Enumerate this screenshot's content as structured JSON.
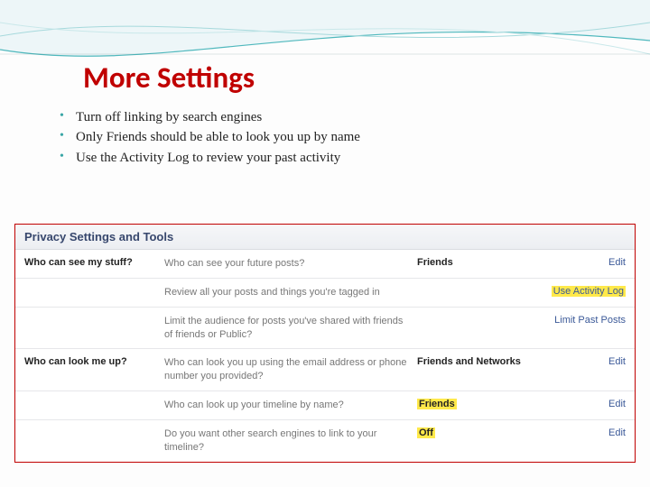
{
  "title": "More Settings",
  "bullets": [
    "Turn off linking by search engines",
    "Only Friends should be able to look you up by name",
    "Use the Activity Log to review your past activity"
  ],
  "panel": {
    "header": "Privacy Settings and Tools",
    "sections": [
      {
        "heading": "Who can see my stuff?",
        "rows": [
          {
            "desc": "Who can see your future posts?",
            "value": "Friends",
            "value_hl": false,
            "action": "Edit",
            "action_hl": false
          },
          {
            "desc": "Review all your posts and things you're tagged in",
            "value": "",
            "value_hl": false,
            "action": "Use Activity Log",
            "action_hl": true
          },
          {
            "desc": "Limit the audience for posts you've shared with friends of friends or Public?",
            "value": "",
            "value_hl": false,
            "action": "Limit Past Posts",
            "action_hl": false
          }
        ]
      },
      {
        "heading": "Who can look me up?",
        "rows": [
          {
            "desc": "Who can look you up using the email address or phone number you provided?",
            "value": "Friends and Networks",
            "value_hl": false,
            "action": "Edit",
            "action_hl": false
          },
          {
            "desc": "Who can look up your timeline by name?",
            "value": "Friends",
            "value_hl": true,
            "action": "Edit",
            "action_hl": false
          },
          {
            "desc": "Do you want other search engines to link to your timeline?",
            "value": "Off",
            "value_hl": true,
            "action": "Edit",
            "action_hl": false
          }
        ]
      }
    ]
  }
}
